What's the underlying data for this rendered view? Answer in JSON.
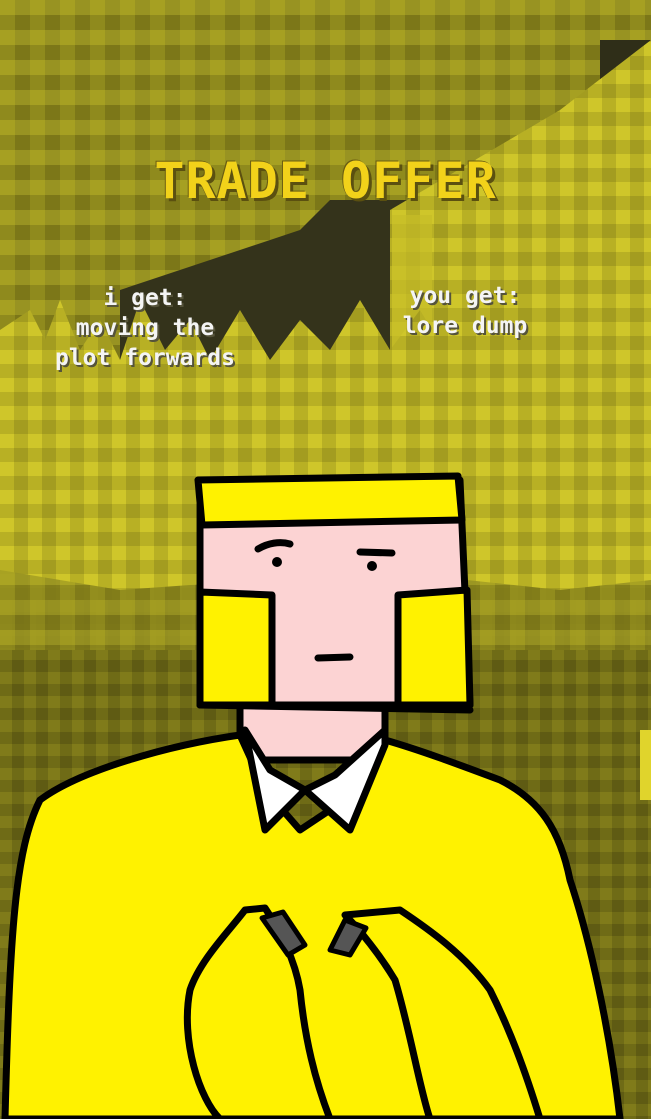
{
  "meme": {
    "title": "TRADE OFFER",
    "i_get": "i get:\nmoving the\nplot forwards",
    "you_get": "you get:\nlore dump"
  },
  "colors": {
    "title_yellow": "#f2d21a",
    "offer_text": "#f4f4f4",
    "character_yellow": "#fff200",
    "skin_pink": "#fcd3d3",
    "outline": "#000000",
    "bg_yellow": "#a8a022",
    "bg_dark": "#3a391c"
  }
}
